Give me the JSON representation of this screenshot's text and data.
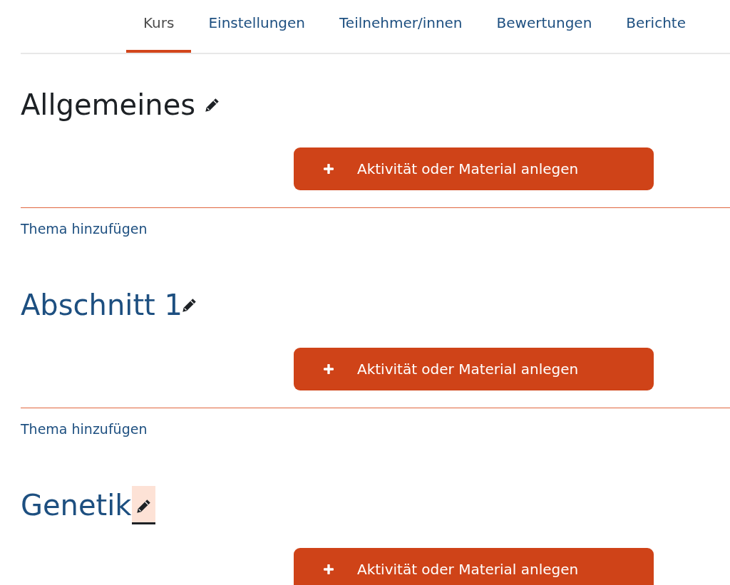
{
  "tabs": [
    {
      "label": "Kurs",
      "selected": true
    },
    {
      "label": "Einstellungen",
      "selected": false
    },
    {
      "label": "Teilnehmer/innen",
      "selected": false
    },
    {
      "label": "Bewertungen",
      "selected": false
    },
    {
      "label": "Berichte",
      "selected": false
    }
  ],
  "sections": [
    {
      "title": "Allgemeines",
      "kind": "plain",
      "focused": false,
      "add_button": "Aktivität oder Material anlegen",
      "add_link": "Thema hinzufügen"
    },
    {
      "title": "Abschnitt 1",
      "kind": "link",
      "focused": false,
      "add_button": "Aktivität oder Material anlegen",
      "add_link": "Thema hinzufügen"
    },
    {
      "title": "Genetik",
      "kind": "link",
      "focused": true,
      "add_button": "Aktivität oder Material anlegen"
    }
  ]
}
